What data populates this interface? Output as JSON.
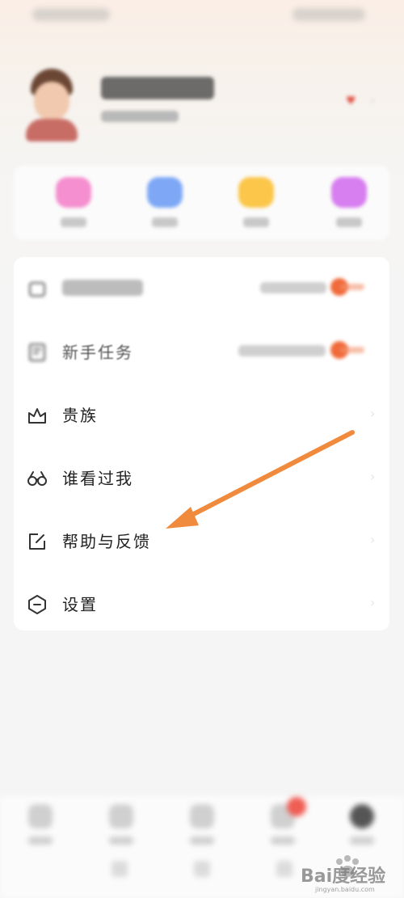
{
  "menu": {
    "items": [
      {
        "label": "新手任务",
        "icon": "task-list-icon"
      },
      {
        "label": "贵族",
        "icon": "crown-icon"
      },
      {
        "label": "谁看过我",
        "icon": "glasses-icon"
      },
      {
        "label": "帮助与反馈",
        "icon": "edit-feedback-icon"
      },
      {
        "label": "设置",
        "icon": "settings-hexagon-icon"
      }
    ]
  },
  "quick_actions": {
    "colors": [
      "#f58fcf",
      "#7ea8f6",
      "#fbc64a",
      "#d77ef0"
    ]
  },
  "annotation": {
    "color": "#f08a3c"
  },
  "watermark": {
    "text": "Bai度经验",
    "url": "jingyan.baidu.com"
  }
}
